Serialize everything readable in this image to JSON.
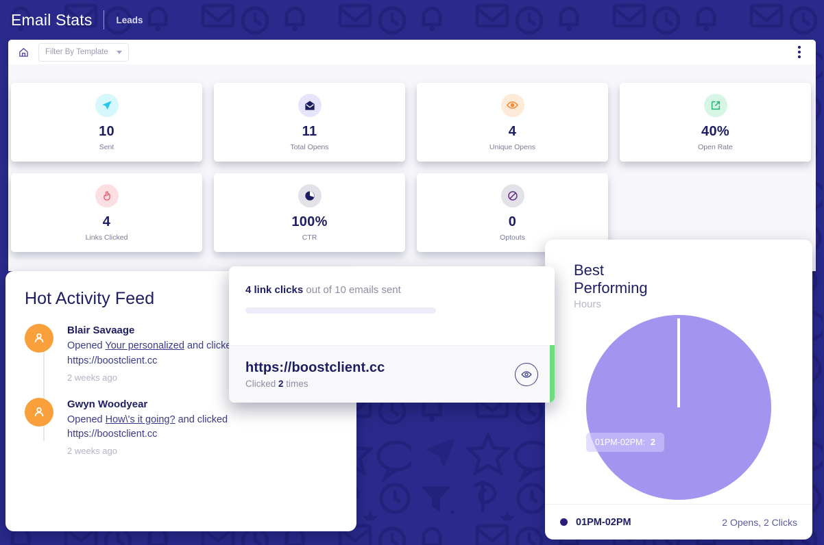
{
  "header": {
    "title": "Email Stats",
    "subtitle": "Leads"
  },
  "toolbar": {
    "home_icon": "home-icon",
    "filter_label": "Filter By Template",
    "menu_icon": "kebab-menu-icon"
  },
  "stats": [
    {
      "value": "10",
      "label": "Sent",
      "icon": "paper-plane-icon",
      "icon_color": "#28c6f0",
      "bg": "#d6f7fb"
    },
    {
      "value": "11",
      "label": "Total Opens",
      "icon": "open-envelope-icon",
      "icon_color": "#1d1d63",
      "bg": "#e6e4fa"
    },
    {
      "value": "4",
      "label": "Unique Opens",
      "icon": "eye-icon",
      "icon_color": "#f58b35",
      "bg": "#fdead8"
    },
    {
      "value": "40%",
      "label": "Open Rate",
      "icon": "external-link-icon",
      "icon_color": "#22b573",
      "bg": "#d6f5e4"
    },
    {
      "value": "4",
      "label": "Links Clicked",
      "icon": "pointing-hand-icon",
      "icon_color": "#e8556a",
      "bg": "#fbdfe2"
    },
    {
      "value": "100%",
      "label": "CTR",
      "icon": "pie-chart-icon",
      "icon_color": "#1d1d63",
      "bg": "#e2e2e8"
    },
    {
      "value": "0",
      "label": "Optouts",
      "icon": "block-icon",
      "icon_color": "#5e2a86",
      "bg": "#e2e2e8"
    }
  ],
  "feed": {
    "title": "Hot Activity Feed",
    "items": [
      {
        "name": "Blair Savaage",
        "text_before": "Opened ",
        "link": "Your personalized",
        "text_after": " and clicked https://boostclient.cc",
        "time": "2 weeks ago",
        "avatar_icon": "user-avatar-icon"
      },
      {
        "name": "Gwyn Woodyear",
        "text_before": "Opened ",
        "link": "How\\'s it going?",
        "text_after": " and clicked https://boostclient.cc",
        "time": "2 weeks ago",
        "avatar_icon": "user-avatar-icon"
      }
    ]
  },
  "link_popup": {
    "headline_bold": "4 link clicks",
    "headline_rest": " out of 10 emails sent",
    "url": "https://boostclient.cc",
    "clicked_before": "Clicked ",
    "clicked_count": "2",
    "clicked_after": " times",
    "eye_icon": "eye-icon",
    "accent_color": "#6ddd7e"
  },
  "hours_card": {
    "title": "Best Performing",
    "subtitle": "Hours",
    "tooltip_label": "01PM-02PM:",
    "tooltip_value": "2",
    "legend_label": "01PM-02PM",
    "legend_value": "2 Opens, 2 Clicks"
  },
  "chart_data": {
    "type": "pie",
    "title": "Best Performing Hours",
    "categories": [
      "01PM-02PM"
    ],
    "values": [
      2
    ],
    "slice_colors": [
      "#a394f0"
    ],
    "legend_position": "bottom",
    "annotations": [
      "01PM-02PM: 2"
    ],
    "series_detail": [
      {
        "name": "01PM-02PM",
        "opens": 2,
        "clicks": 2,
        "percent": 100
      }
    ]
  },
  "colors": {
    "brand_navy": "#2a2a8c",
    "accent_purple": "#a394f0",
    "accent_green": "#6ddd7e",
    "avatar_orange": "#f9a03c"
  }
}
